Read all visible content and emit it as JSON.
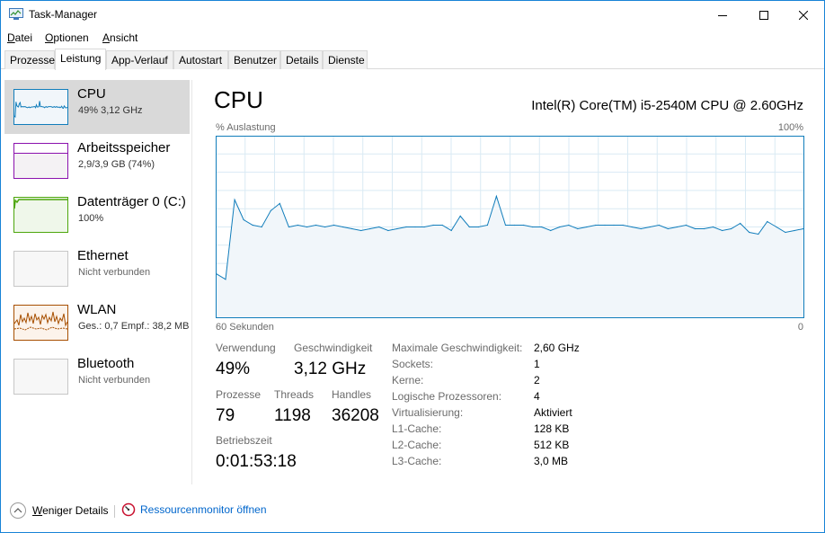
{
  "window": {
    "title": "Task-Manager"
  },
  "menu": [
    {
      "label": "Datei",
      "accel": "D",
      "rest": "atei"
    },
    {
      "label": "Optionen",
      "accel": "O",
      "rest": "ptionen"
    },
    {
      "label": "Ansicht",
      "accel": "A",
      "rest": "nsicht"
    }
  ],
  "tabs": [
    {
      "label": "Prozesse"
    },
    {
      "label": "Leistung"
    },
    {
      "label": "App-Verlauf"
    },
    {
      "label": "Autostart"
    },
    {
      "label": "Benutzer"
    },
    {
      "label": "Details"
    },
    {
      "label": "Dienste"
    }
  ],
  "active_tab": "Leistung",
  "sidebar": {
    "items": [
      {
        "name": "CPU",
        "sub": "49% 3,12 GHz",
        "color": "#117dbb"
      },
      {
        "name": "Arbeitsspeicher",
        "sub": "2,9/3,9 GB (74%)",
        "color": "#8b12ae",
        "fill_fraction": 0.74
      },
      {
        "name": "Datenträger 0 (C:)",
        "sub": "100%",
        "color": "#4da60c"
      },
      {
        "name": "Ethernet",
        "sub": "Nicht verbunden",
        "color": "#b3b3b3"
      },
      {
        "name": "WLAN",
        "sub": "Ges.: 0,7 Empf.: 38,2 MB",
        "color": "#a74f01"
      },
      {
        "name": "Bluetooth",
        "sub": "Nicht verbunden",
        "color": "#b3b3b3"
      }
    ]
  },
  "main": {
    "title": "CPU",
    "cpu_model": "Intel(R) Core(TM) i5-2540M CPU @ 2.60GHz",
    "chart_label_left": "% Auslastung",
    "chart_label_right": "100%",
    "time_left": "60 Sekunden",
    "time_right": "0"
  },
  "chart_data": {
    "type": "area",
    "title": "",
    "ylabel": "% Auslastung",
    "xlabel": "60 Sekunden",
    "ylim": [
      0,
      100
    ],
    "x": [
      60,
      59,
      58,
      57,
      56,
      55,
      54,
      53,
      52,
      51,
      50,
      49,
      48,
      47,
      46,
      45,
      44,
      43,
      42,
      41,
      40,
      39,
      38,
      37,
      36,
      35,
      34,
      33,
      32,
      31,
      30,
      29,
      28,
      27,
      26,
      25,
      24,
      23,
      22,
      21,
      20,
      19,
      18,
      17,
      16,
      15,
      14,
      13,
      12,
      11,
      10,
      9,
      8,
      7,
      6,
      5,
      4,
      3,
      2,
      1,
      0
    ],
    "values": [
      24,
      21,
      65,
      54,
      51,
      50,
      59,
      63,
      50,
      51,
      50,
      51,
      50,
      51,
      50,
      49,
      48,
      49,
      50,
      48,
      49,
      50,
      50,
      50,
      51,
      51,
      48,
      56,
      50,
      50,
      51,
      67,
      51,
      51,
      51,
      50,
      50,
      48,
      50,
      51,
      49,
      50,
      51,
      51,
      51,
      51,
      50,
      49,
      50,
      51,
      49,
      50,
      51,
      49,
      49,
      50,
      48,
      49,
      52,
      47,
      46,
      53,
      50,
      47,
      48,
      49
    ],
    "grid": true,
    "color": "#117dbb",
    "fill": "#f1f6fa"
  },
  "stats": {
    "usage_label": "Verwendung",
    "usage_value": "49%",
    "speed_label": "Geschwindigkeit",
    "speed_value": "3,12 GHz",
    "processes_label": "Prozesse",
    "processes_value": "79",
    "threads_label": "Threads",
    "threads_value": "1198",
    "handles_label": "Handles",
    "handles_value": "36208",
    "uptime_label": "Betriebszeit",
    "uptime_value": "0:01:53:18"
  },
  "specs": [
    {
      "key": "Maximale Geschwindigkeit:",
      "value": "2,60 GHz"
    },
    {
      "key": "Sockets:",
      "value": "1"
    },
    {
      "key": "Kerne:",
      "value": "2"
    },
    {
      "key": "Logische Prozessoren:",
      "value": "4"
    },
    {
      "key": "Virtualisierung:",
      "value": "Aktiviert"
    },
    {
      "key": "L1-Cache:",
      "value": "128 KB"
    },
    {
      "key": "L2-Cache:",
      "value": "512 KB"
    },
    {
      "key": "L3-Cache:",
      "value": "3,0 MB"
    }
  ],
  "footer": {
    "fewer_details": "Weniger Details",
    "fewer_accel": "W",
    "fewer_rest": "eniger Details",
    "resmon": "Ressourcenmonitor öffnen"
  }
}
